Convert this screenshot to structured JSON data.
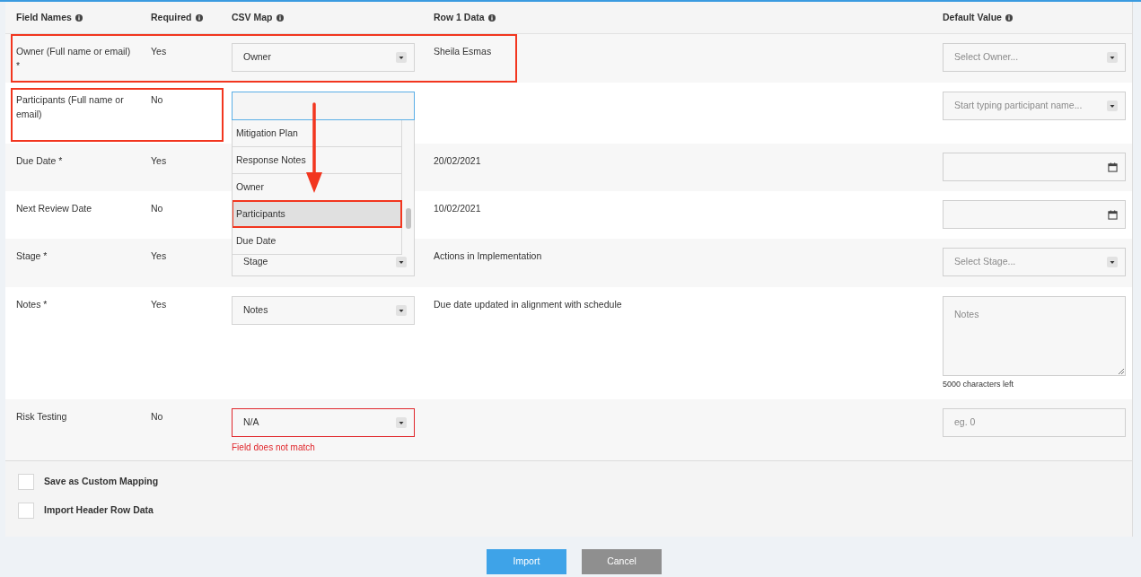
{
  "columns": [
    "Field Names",
    "Required",
    "CSV Map",
    "Row 1 Data",
    "Default Value"
  ],
  "rows": [
    {
      "field": "Owner (Full name or email) *",
      "required": "Yes",
      "csv": {
        "kind": "select",
        "value": "Owner"
      },
      "row_data": "Sheila Esmas",
      "default": {
        "kind": "select",
        "placeholder": "Select Owner..."
      },
      "annotated": true
    },
    {
      "field": "Participants (Full name or email)",
      "required": "No",
      "csv": {
        "kind": "open"
      },
      "default": {
        "kind": "select",
        "placeholder": "Start typing participant name..."
      },
      "annotated": true
    },
    {
      "field": "Due Date *",
      "required": "Yes",
      "csv": {
        "kind": "hidden"
      },
      "row_data": "20/02/2021",
      "default": {
        "kind": "date"
      }
    },
    {
      "field": "Next Review Date",
      "required": "No",
      "csv": {
        "kind": "hidden"
      },
      "row_data": "10/02/2021",
      "default": {
        "kind": "date"
      }
    },
    {
      "field": "Stage *",
      "required": "Yes",
      "csv": {
        "kind": "select",
        "value": "Stage"
      },
      "row_data": "Actions in Implementation",
      "default": {
        "kind": "select",
        "placeholder": "Select Stage..."
      }
    },
    {
      "field": "Notes *",
      "required": "Yes",
      "csv": {
        "kind": "select",
        "value": "Notes"
      },
      "row_data": "Due date updated in alignment with schedule",
      "default": {
        "kind": "textarea",
        "placeholder": "Notes",
        "counter": "5000 characters left"
      }
    },
    {
      "field": "Risk Testing",
      "required": "No",
      "csv": {
        "kind": "select",
        "value": "N/A",
        "error": "Field does not match"
      },
      "default": {
        "kind": "text",
        "placeholder": "eg. 0"
      }
    }
  ],
  "dropdown": {
    "arrow": true,
    "options": [
      {
        "label": "Mitigation Plan",
        "selected": false,
        "annotated": false
      },
      {
        "label": "Response Notes",
        "selected": false,
        "annotated": false
      },
      {
        "label": "Owner",
        "selected": false,
        "annotated": false
      },
      {
        "label": "Participants",
        "selected": true,
        "annotated": true
      },
      {
        "label": "Due Date",
        "selected": false,
        "annotated": false
      }
    ]
  },
  "options": [
    {
      "label": "Save as Custom Mapping",
      "checked": false
    },
    {
      "label": "Import Header Row Data",
      "checked": false
    }
  ],
  "buttons": [
    {
      "label": "Import",
      "kind": "primary"
    },
    {
      "label": "Cancel",
      "kind": "secondary"
    }
  ]
}
